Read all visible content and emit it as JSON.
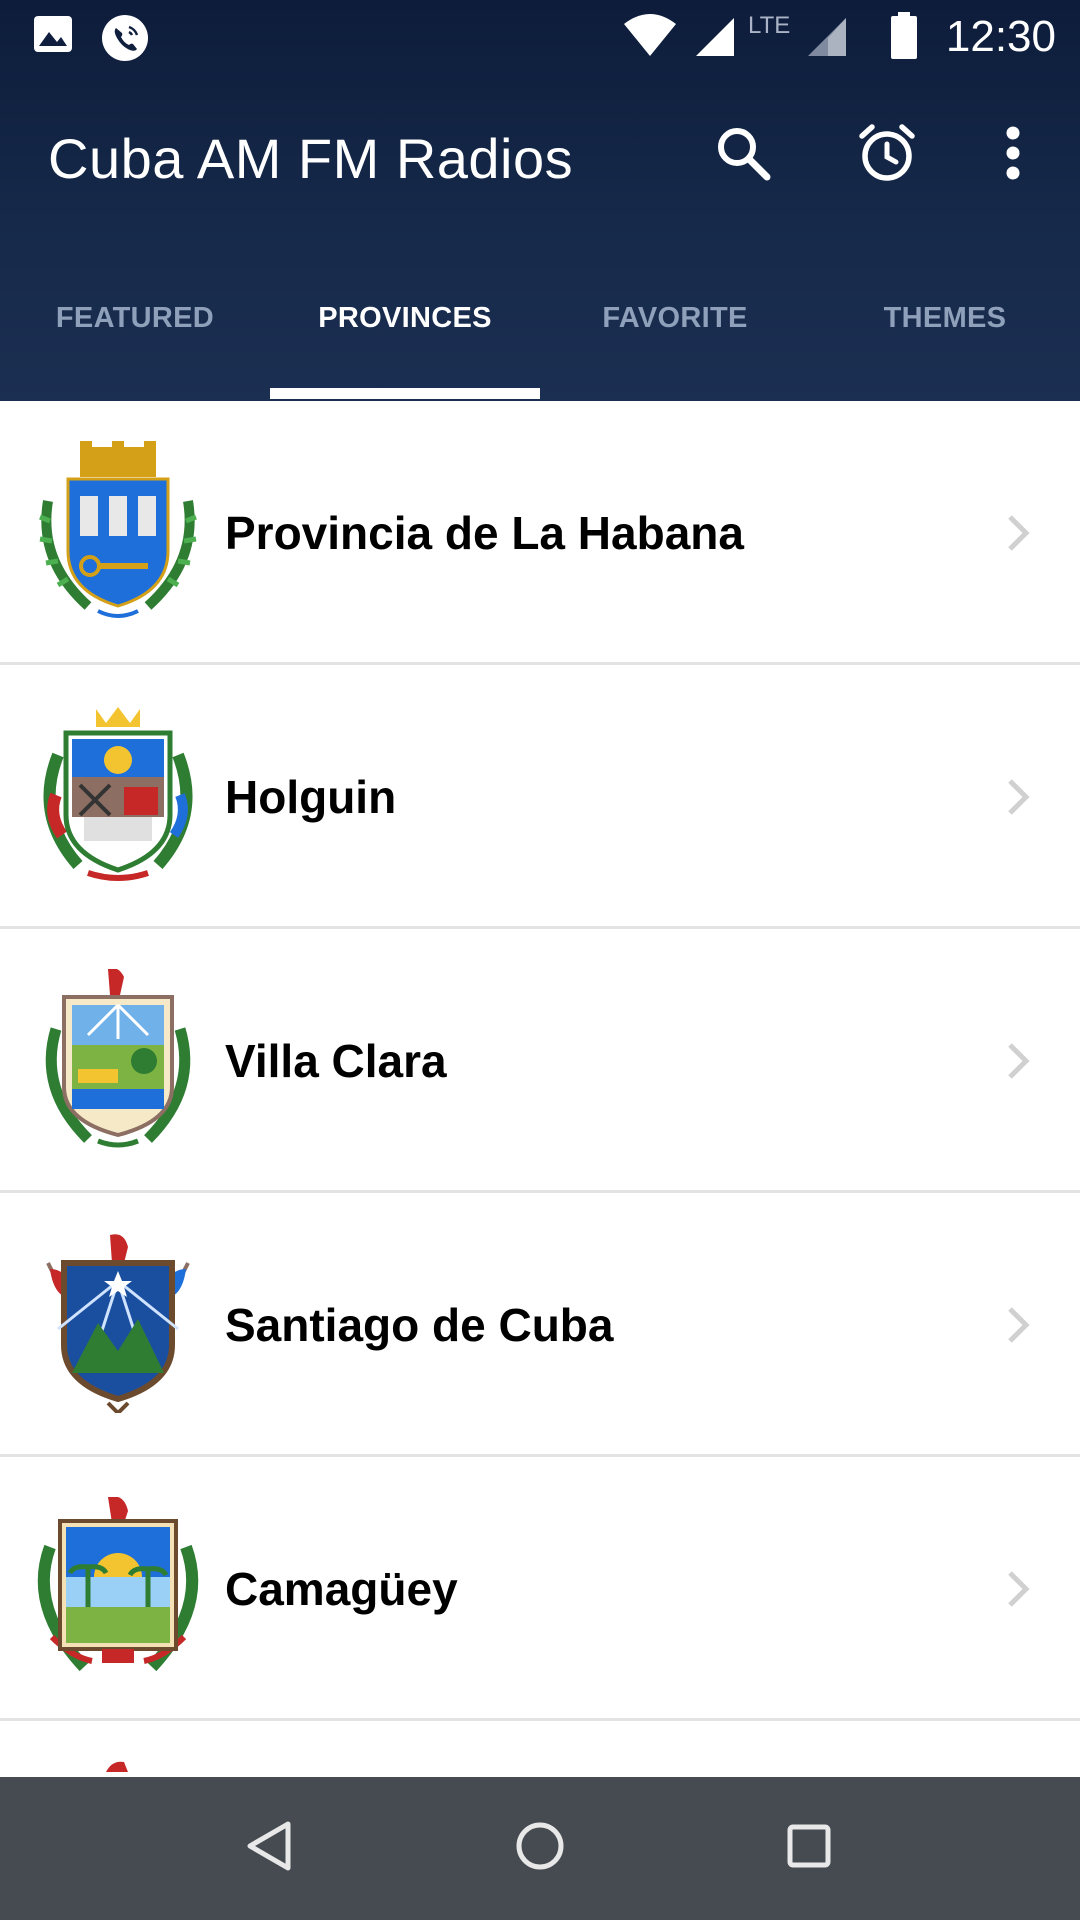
{
  "status_bar": {
    "time": "12:30",
    "network_label": "LTE",
    "icons": [
      "image-icon",
      "phone-call-icon",
      "wifi-icon",
      "signal-icon",
      "lte-signal-icon",
      "battery-icon"
    ]
  },
  "toolbar": {
    "title": "Cuba AM FM Radios",
    "actions": [
      "search-icon",
      "alarm-clock-icon",
      "more-vert-icon"
    ]
  },
  "tabs": [
    {
      "label": "FEATURED",
      "active": false
    },
    {
      "label": "PROVINCES",
      "active": true
    },
    {
      "label": "FAVORITE",
      "active": false
    },
    {
      "label": "THEMES",
      "active": false
    }
  ],
  "provinces": [
    {
      "name": "Provincia de La Habana",
      "emblem": "la-habana-coat-of-arms"
    },
    {
      "name": "Holguin",
      "emblem": "holguin-coat-of-arms"
    },
    {
      "name": "Villa Clara",
      "emblem": "villa-clara-coat-of-arms"
    },
    {
      "name": "Santiago de Cuba",
      "emblem": "santiago-de-cuba-coat-of-arms"
    },
    {
      "name": "Camagüey",
      "emblem": "camaguey-coat-of-arms"
    }
  ],
  "nav_bar": [
    "back-icon",
    "home-icon",
    "recents-icon"
  ],
  "colors": {
    "header_top": "#0d1c3a",
    "header_bottom": "#1b2f52",
    "tab_inactive": "#8fa0ba",
    "tab_active": "#ffffff",
    "divider": "#e3e3e3",
    "navbar": "#454b50"
  }
}
